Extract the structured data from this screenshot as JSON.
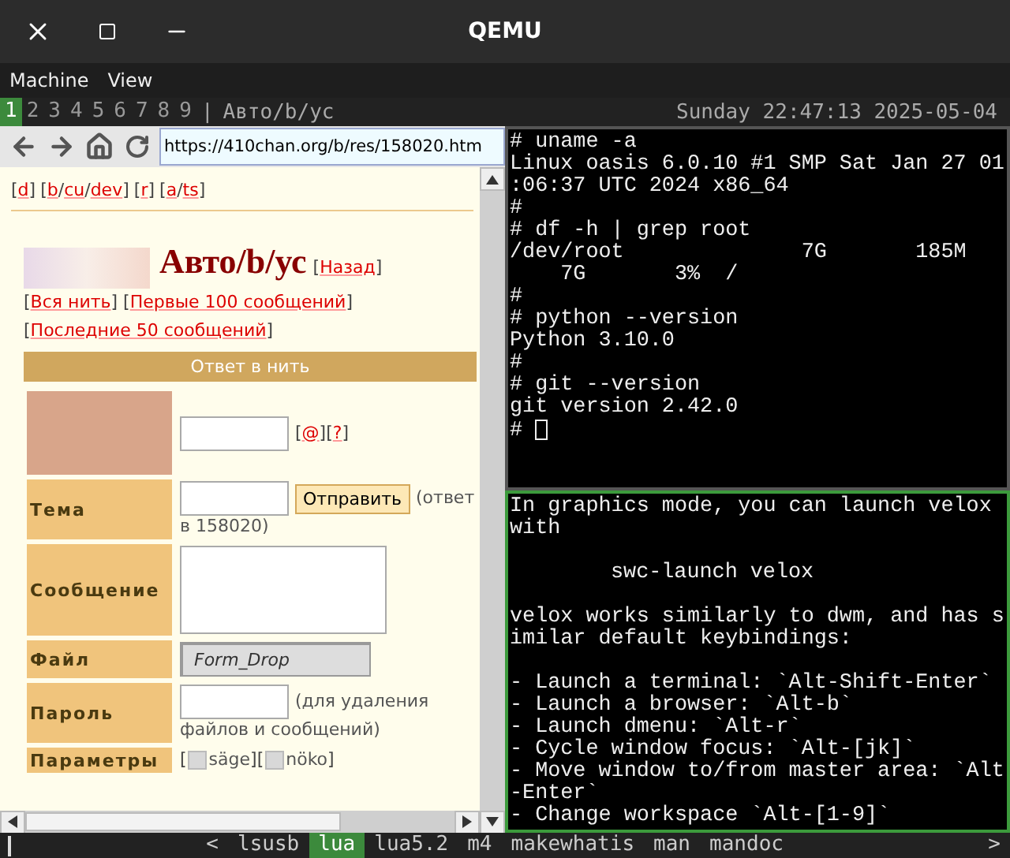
{
  "window": {
    "title": "QEMU"
  },
  "menu": [
    "Machine",
    "View"
  ],
  "tag_bar": {
    "tags": [
      {
        "label": "1",
        "selected": true
      },
      {
        "label": "2",
        "selected": false
      },
      {
        "label": "3",
        "selected": false
      },
      {
        "label": "4",
        "selected": false
      },
      {
        "label": "5",
        "selected": false
      },
      {
        "label": "6",
        "selected": false
      },
      {
        "label": "7",
        "selected": false
      },
      {
        "label": "8",
        "selected": false
      },
      {
        "label": "9",
        "selected": false
      }
    ],
    "separator": "|",
    "window_title": "Aвто/b/ус",
    "clock": "Sunday 22:47:13 2025-05-04"
  },
  "browser": {
    "url": "https://410chan.org/b/res/158020.htm",
    "brackets": [
      "[",
      "]"
    ],
    "slash": "/",
    "board_nav": [
      [
        "d"
      ],
      [
        "b",
        "cu",
        "dev"
      ],
      [
        "r"
      ],
      [
        "a",
        "ts"
      ]
    ],
    "thread_title": "Авто/b/ус",
    "thread_links": [
      "Назад",
      "Вся нить",
      "Первые 100 сообщений",
      "Последние 50 сообщений"
    ],
    "reply_bar": "Ответ в нить",
    "form": {
      "email_links": [
        "@",
        "?"
      ],
      "rows": [
        {
          "kind": "subject",
          "label": "Тема",
          "button": "Отправить",
          "note": [
            "(ответ",
            "в 158020)"
          ]
        },
        {
          "kind": "message",
          "label": "Сообщение"
        },
        {
          "kind": "file",
          "label": "Файл",
          "value": "Form_Drop"
        },
        {
          "kind": "password",
          "label": "Пароль",
          "note": [
            "(для удаления",
            "файлов и сообщений)"
          ]
        },
        {
          "kind": "options",
          "label": "Параметры",
          "options": [
            {
              "label": "säge",
              "checked": false
            },
            {
              "label": "nöko",
              "checked": false
            }
          ]
        }
      ]
    }
  },
  "terminal_top": {
    "focused": false,
    "lines": [
      "# uname -a",
      "Linux oasis 6.0.10 #1 SMP Sat Jan 27 01",
      ":06:37 UTC 2024 x86_64",
      "#",
      "# df -h | grep root",
      "/dev/root              7G       185M",
      "    7G       3%  /",
      "#",
      "# python --version",
      "Python 3.10.0",
      "#",
      "# git --version",
      "git version 2.42.0",
      "#"
    ]
  },
  "terminal_bottom": {
    "focused": true,
    "paragraphs": [
      {
        "kind": "text",
        "lines": [
          "In graphics mode, you can launch velox",
          "with"
        ]
      },
      {
        "kind": "indented",
        "lines": [
          "swc-launch velox"
        ]
      },
      {
        "kind": "text",
        "lines": [
          "velox works similarly to dwm, and has s",
          "imilar default keybindings:"
        ]
      },
      {
        "kind": "text",
        "lines": [
          "- Launch a terminal: `Alt-Shift-Enter`",
          "- Launch a browser: `Alt-b`",
          "- Launch dmenu: `Alt-r`",
          "- Cycle window focus: `Alt-[jk]`",
          "- Move window to/from master area: `Alt",
          "-Enter`",
          "- Change workspace `Alt-[1-9]`"
        ]
      }
    ]
  },
  "launcher": {
    "prev": "<",
    "next": ">",
    "items": [
      {
        "label": "lsusb",
        "selected": false
      },
      {
        "label": "lua",
        "selected": true
      },
      {
        "label": "lua5.2",
        "selected": false
      },
      {
        "label": "m4",
        "selected": false
      },
      {
        "label": "makewhatis",
        "selected": false
      },
      {
        "label": "man",
        "selected": false
      },
      {
        "label": "mandoc",
        "selected": false
      }
    ]
  }
}
